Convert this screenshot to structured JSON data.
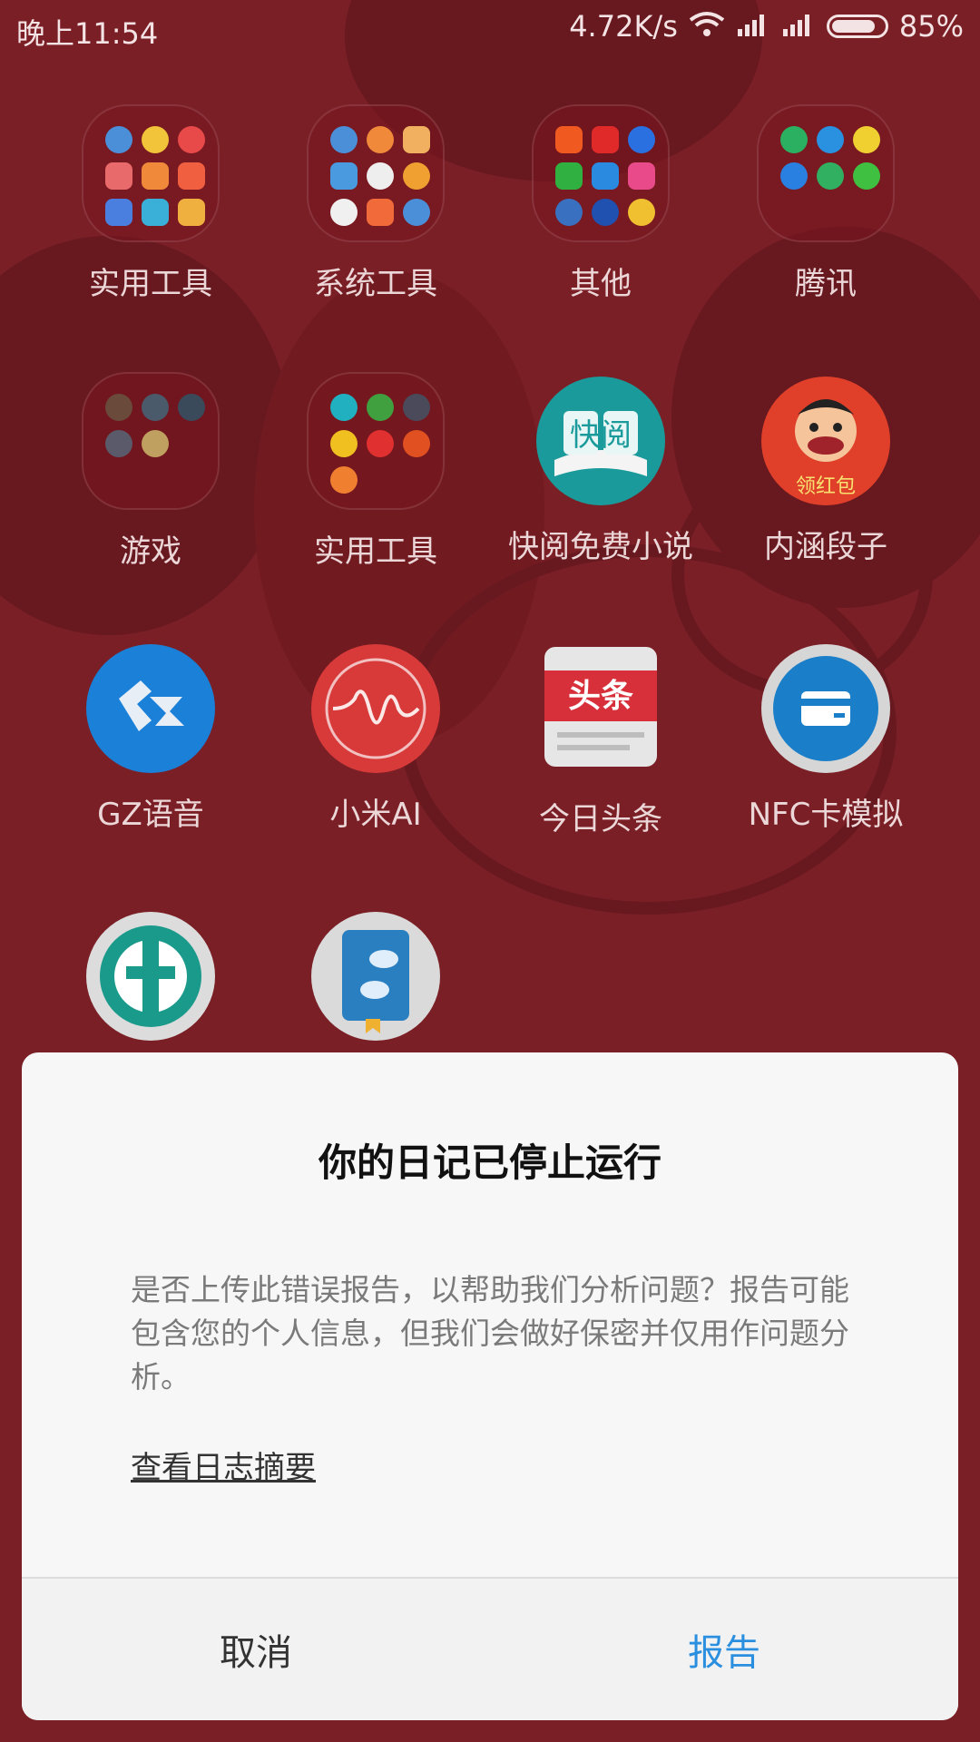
{
  "status_bar": {
    "time": "晚上11:54",
    "network_speed": "4.72K/s",
    "battery_percent": "85%",
    "battery_level": 0.85
  },
  "apps": [
    {
      "label": "实用工具",
      "type": "folder"
    },
    {
      "label": "系统工具",
      "type": "folder"
    },
    {
      "label": "其他",
      "type": "folder"
    },
    {
      "label": "腾讯",
      "type": "folder"
    },
    {
      "label": "游戏",
      "type": "folder"
    },
    {
      "label": "实用工具",
      "type": "folder"
    },
    {
      "label": "快阅免费小说",
      "type": "app",
      "icon_text": "快阅"
    },
    {
      "label": "内涵段子",
      "type": "app",
      "icon_text": "领红包"
    },
    {
      "label": "GZ语音",
      "type": "app"
    },
    {
      "label": "小米AI",
      "type": "app"
    },
    {
      "label": "今日头条",
      "type": "app",
      "icon_text": "头条"
    },
    {
      "label": "NFC卡模拟",
      "type": "app"
    },
    {
      "label": "",
      "type": "app"
    },
    {
      "label": "",
      "type": "app"
    }
  ],
  "dialog": {
    "title": "你的日记已停止运行",
    "message": "是否上传此错误报告，以帮助我们分析问题？报告可能包含您的个人信息，但我们会做好保密并仅用作问题分析。",
    "link": "查看日志摘要",
    "cancel_label": "取消",
    "report_label": "报告"
  },
  "colors": {
    "wallpaper": "#96262f",
    "accent": "#2b8fe0"
  }
}
